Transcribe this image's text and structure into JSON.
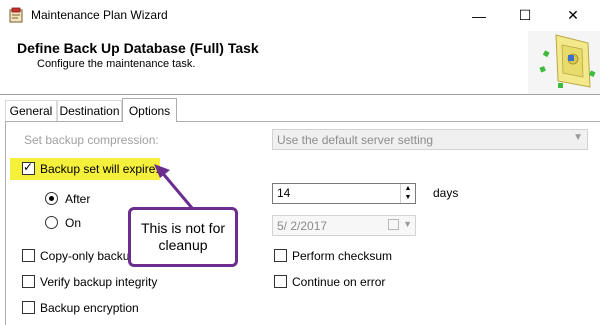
{
  "window": {
    "title": "Maintenance Plan Wizard",
    "app_icon": "wizard-icon",
    "controls": {
      "minimize": "—",
      "maximize": "☐",
      "close": "✕"
    }
  },
  "header": {
    "title": "Define Back Up Database (Full) Task",
    "subtitle": "Configure the maintenance task."
  },
  "tabs": [
    {
      "label": "General",
      "selected": false
    },
    {
      "label": "Destination",
      "selected": false
    },
    {
      "label": "Options",
      "selected": true
    }
  ],
  "options": {
    "compression_label": "Set backup compression:",
    "compression_value": "Use the default server setting",
    "expire_label": "Backup set will expire:",
    "expire_checked": true,
    "after_label": "After",
    "after_value": "14",
    "after_unit": "days",
    "on_label": "On",
    "on_date": "5/  2/2017",
    "copy_only_label": "Copy-only backup",
    "verify_label": "Verify backup integrity",
    "encryption_label": "Backup encryption",
    "checksum_label": "Perform checksum",
    "continue_label": "Continue on error"
  },
  "annotation": {
    "callout_text": "This is not for cleanup",
    "callout_color": "#6b2d8e",
    "highlight_color": "#f5f03c"
  }
}
